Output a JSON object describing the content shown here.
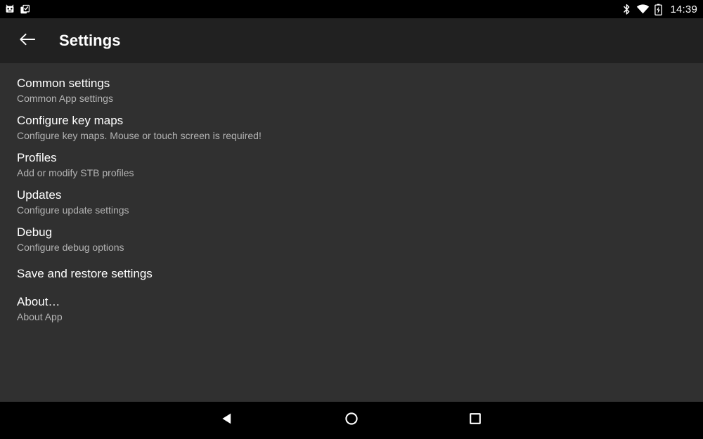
{
  "status_bar": {
    "notification_icons": [
      "android-robot-icon",
      "clipboard-check-icon"
    ],
    "system_icons": [
      "bluetooth-icon",
      "wifi-icon",
      "battery-charging-icon"
    ],
    "clock": "14:39",
    "background_color": "#000000",
    "icon_color": "#ffffff"
  },
  "toolbar": {
    "back_icon": "arrow-left-icon",
    "title": "Settings",
    "background_color": "#212121",
    "title_color": "#ffffff"
  },
  "content": {
    "background_color": "#303030",
    "title_color": "#ffffff",
    "summary_color": "#b3b3b3",
    "items": [
      {
        "title": "Common settings",
        "summary": "Common App settings"
      },
      {
        "title": "Configure key maps",
        "summary": "Configure key maps. Mouse or touch screen is required!"
      },
      {
        "title": "Profiles",
        "summary": "Add or modify STB profiles"
      },
      {
        "title": "Updates",
        "summary": "Configure update settings"
      },
      {
        "title": "Debug",
        "summary": "Configure debug options"
      },
      {
        "title": "Save and restore settings",
        "summary": ""
      },
      {
        "title": "About…",
        "summary": "About App"
      }
    ]
  },
  "nav_bar": {
    "background_color": "#000000",
    "buttons": [
      {
        "name": "back-triangle-icon"
      },
      {
        "name": "home-circle-icon"
      },
      {
        "name": "recents-square-icon"
      }
    ]
  }
}
